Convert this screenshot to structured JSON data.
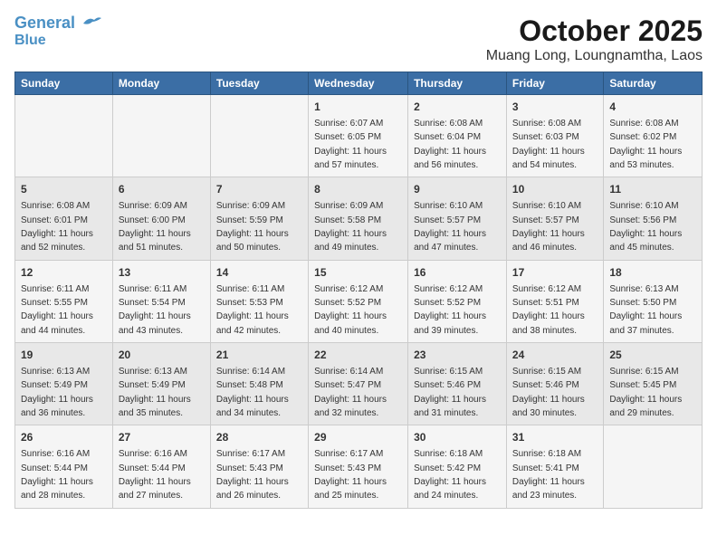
{
  "logo": {
    "line1": "General",
    "line2": "Blue"
  },
  "title": "October 2025",
  "subtitle": "Muang Long, Loungnamtha, Laos",
  "weekdays": [
    "Sunday",
    "Monday",
    "Tuesday",
    "Wednesday",
    "Thursday",
    "Friday",
    "Saturday"
  ],
  "weeks": [
    [
      {
        "day": "",
        "sunrise": "",
        "sunset": "",
        "daylight": ""
      },
      {
        "day": "",
        "sunrise": "",
        "sunset": "",
        "daylight": ""
      },
      {
        "day": "",
        "sunrise": "",
        "sunset": "",
        "daylight": ""
      },
      {
        "day": "1",
        "sunrise": "Sunrise: 6:07 AM",
        "sunset": "Sunset: 6:05 PM",
        "daylight": "Daylight: 11 hours and 57 minutes."
      },
      {
        "day": "2",
        "sunrise": "Sunrise: 6:08 AM",
        "sunset": "Sunset: 6:04 PM",
        "daylight": "Daylight: 11 hours and 56 minutes."
      },
      {
        "day": "3",
        "sunrise": "Sunrise: 6:08 AM",
        "sunset": "Sunset: 6:03 PM",
        "daylight": "Daylight: 11 hours and 54 minutes."
      },
      {
        "day": "4",
        "sunrise": "Sunrise: 6:08 AM",
        "sunset": "Sunset: 6:02 PM",
        "daylight": "Daylight: 11 hours and 53 minutes."
      }
    ],
    [
      {
        "day": "5",
        "sunrise": "Sunrise: 6:08 AM",
        "sunset": "Sunset: 6:01 PM",
        "daylight": "Daylight: 11 hours and 52 minutes."
      },
      {
        "day": "6",
        "sunrise": "Sunrise: 6:09 AM",
        "sunset": "Sunset: 6:00 PM",
        "daylight": "Daylight: 11 hours and 51 minutes."
      },
      {
        "day": "7",
        "sunrise": "Sunrise: 6:09 AM",
        "sunset": "Sunset: 5:59 PM",
        "daylight": "Daylight: 11 hours and 50 minutes."
      },
      {
        "day": "8",
        "sunrise": "Sunrise: 6:09 AM",
        "sunset": "Sunset: 5:58 PM",
        "daylight": "Daylight: 11 hours and 49 minutes."
      },
      {
        "day": "9",
        "sunrise": "Sunrise: 6:10 AM",
        "sunset": "Sunset: 5:57 PM",
        "daylight": "Daylight: 11 hours and 47 minutes."
      },
      {
        "day": "10",
        "sunrise": "Sunrise: 6:10 AM",
        "sunset": "Sunset: 5:57 PM",
        "daylight": "Daylight: 11 hours and 46 minutes."
      },
      {
        "day": "11",
        "sunrise": "Sunrise: 6:10 AM",
        "sunset": "Sunset: 5:56 PM",
        "daylight": "Daylight: 11 hours and 45 minutes."
      }
    ],
    [
      {
        "day": "12",
        "sunrise": "Sunrise: 6:11 AM",
        "sunset": "Sunset: 5:55 PM",
        "daylight": "Daylight: 11 hours and 44 minutes."
      },
      {
        "day": "13",
        "sunrise": "Sunrise: 6:11 AM",
        "sunset": "Sunset: 5:54 PM",
        "daylight": "Daylight: 11 hours and 43 minutes."
      },
      {
        "day": "14",
        "sunrise": "Sunrise: 6:11 AM",
        "sunset": "Sunset: 5:53 PM",
        "daylight": "Daylight: 11 hours and 42 minutes."
      },
      {
        "day": "15",
        "sunrise": "Sunrise: 6:12 AM",
        "sunset": "Sunset: 5:52 PM",
        "daylight": "Daylight: 11 hours and 40 minutes."
      },
      {
        "day": "16",
        "sunrise": "Sunrise: 6:12 AM",
        "sunset": "Sunset: 5:52 PM",
        "daylight": "Daylight: 11 hours and 39 minutes."
      },
      {
        "day": "17",
        "sunrise": "Sunrise: 6:12 AM",
        "sunset": "Sunset: 5:51 PM",
        "daylight": "Daylight: 11 hours and 38 minutes."
      },
      {
        "day": "18",
        "sunrise": "Sunrise: 6:13 AM",
        "sunset": "Sunset: 5:50 PM",
        "daylight": "Daylight: 11 hours and 37 minutes."
      }
    ],
    [
      {
        "day": "19",
        "sunrise": "Sunrise: 6:13 AM",
        "sunset": "Sunset: 5:49 PM",
        "daylight": "Daylight: 11 hours and 36 minutes."
      },
      {
        "day": "20",
        "sunrise": "Sunrise: 6:13 AM",
        "sunset": "Sunset: 5:49 PM",
        "daylight": "Daylight: 11 hours and 35 minutes."
      },
      {
        "day": "21",
        "sunrise": "Sunrise: 6:14 AM",
        "sunset": "Sunset: 5:48 PM",
        "daylight": "Daylight: 11 hours and 34 minutes."
      },
      {
        "day": "22",
        "sunrise": "Sunrise: 6:14 AM",
        "sunset": "Sunset: 5:47 PM",
        "daylight": "Daylight: 11 hours and 32 minutes."
      },
      {
        "day": "23",
        "sunrise": "Sunrise: 6:15 AM",
        "sunset": "Sunset: 5:46 PM",
        "daylight": "Daylight: 11 hours and 31 minutes."
      },
      {
        "day": "24",
        "sunrise": "Sunrise: 6:15 AM",
        "sunset": "Sunset: 5:46 PM",
        "daylight": "Daylight: 11 hours and 30 minutes."
      },
      {
        "day": "25",
        "sunrise": "Sunrise: 6:15 AM",
        "sunset": "Sunset: 5:45 PM",
        "daylight": "Daylight: 11 hours and 29 minutes."
      }
    ],
    [
      {
        "day": "26",
        "sunrise": "Sunrise: 6:16 AM",
        "sunset": "Sunset: 5:44 PM",
        "daylight": "Daylight: 11 hours and 28 minutes."
      },
      {
        "day": "27",
        "sunrise": "Sunrise: 6:16 AM",
        "sunset": "Sunset: 5:44 PM",
        "daylight": "Daylight: 11 hours and 27 minutes."
      },
      {
        "day": "28",
        "sunrise": "Sunrise: 6:17 AM",
        "sunset": "Sunset: 5:43 PM",
        "daylight": "Daylight: 11 hours and 26 minutes."
      },
      {
        "day": "29",
        "sunrise": "Sunrise: 6:17 AM",
        "sunset": "Sunset: 5:43 PM",
        "daylight": "Daylight: 11 hours and 25 minutes."
      },
      {
        "day": "30",
        "sunrise": "Sunrise: 6:18 AM",
        "sunset": "Sunset: 5:42 PM",
        "daylight": "Daylight: 11 hours and 24 minutes."
      },
      {
        "day": "31",
        "sunrise": "Sunrise: 6:18 AM",
        "sunset": "Sunset: 5:41 PM",
        "daylight": "Daylight: 11 hours and 23 minutes."
      },
      {
        "day": "",
        "sunrise": "",
        "sunset": "",
        "daylight": ""
      }
    ]
  ]
}
